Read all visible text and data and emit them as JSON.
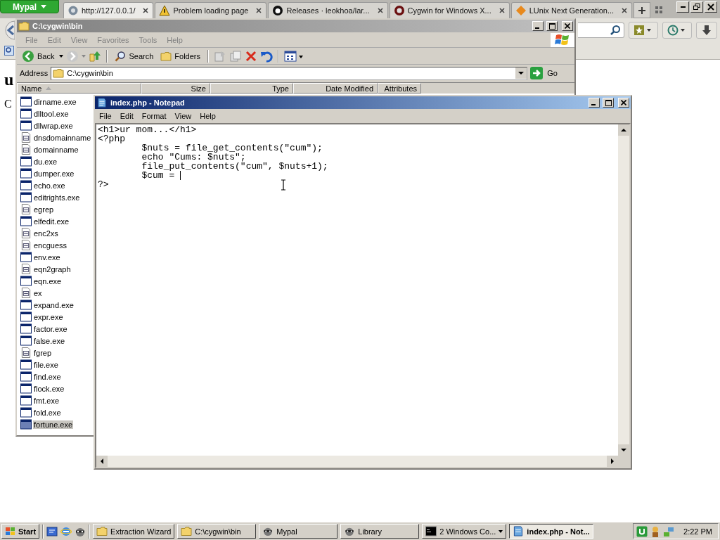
{
  "browser": {
    "menu_button": "Mypal",
    "tabs": [
      {
        "title": "http://127.0.0.1/",
        "kind": "page",
        "selected": true
      },
      {
        "title": "Problem loading page",
        "kind": "warning",
        "selected": false
      },
      {
        "title": "Releases · leokhoa/lar...",
        "kind": "github",
        "selected": false
      },
      {
        "title": "Cygwin for Windows X...",
        "kind": "cygwin",
        "selected": false
      },
      {
        "title": "LUnix Next Generation...",
        "kind": "diamond",
        "selected": false
      }
    ],
    "page_text": [
      "u",
      "C"
    ]
  },
  "explorer": {
    "title": "C:\\cygwin\\bin",
    "menu": [
      "File",
      "Edit",
      "View",
      "Favorites",
      "Tools",
      "Help"
    ],
    "back": "Back",
    "search": "Search",
    "folders": "Folders",
    "address_label": "Address",
    "address": "C:\\cygwin\\bin",
    "go": "Go",
    "columns": [
      "Name",
      "Size",
      "Type",
      "Date Modified",
      "Attributes"
    ],
    "files": [
      {
        "name": "dirname.exe",
        "kind": "exe",
        "selected": false
      },
      {
        "name": "dlltool.exe",
        "kind": "exe",
        "selected": false
      },
      {
        "name": "dllwrap.exe",
        "kind": "exe",
        "selected": false
      },
      {
        "name": "dnsdomainname",
        "kind": "script",
        "selected": false
      },
      {
        "name": "domainname",
        "kind": "script",
        "selected": false
      },
      {
        "name": "du.exe",
        "kind": "exe",
        "selected": false
      },
      {
        "name": "dumper.exe",
        "kind": "exe",
        "selected": false
      },
      {
        "name": "echo.exe",
        "kind": "exe",
        "selected": false
      },
      {
        "name": "editrights.exe",
        "kind": "exe",
        "selected": false
      },
      {
        "name": "egrep",
        "kind": "script",
        "selected": false
      },
      {
        "name": "elfedit.exe",
        "kind": "exe",
        "selected": false
      },
      {
        "name": "enc2xs",
        "kind": "script",
        "selected": false
      },
      {
        "name": "encguess",
        "kind": "script",
        "selected": false
      },
      {
        "name": "env.exe",
        "kind": "exe",
        "selected": false
      },
      {
        "name": "eqn2graph",
        "kind": "script",
        "selected": false
      },
      {
        "name": "eqn.exe",
        "kind": "exe",
        "selected": false
      },
      {
        "name": "ex",
        "kind": "script",
        "selected": false
      },
      {
        "name": "expand.exe",
        "kind": "exe",
        "selected": false
      },
      {
        "name": "expr.exe",
        "kind": "exe",
        "selected": false
      },
      {
        "name": "factor.exe",
        "kind": "exe",
        "selected": false
      },
      {
        "name": "false.exe",
        "kind": "exe",
        "selected": false
      },
      {
        "name": "fgrep",
        "kind": "script",
        "selected": false
      },
      {
        "name": "file.exe",
        "kind": "exe",
        "selected": false
      },
      {
        "name": "find.exe",
        "kind": "exe",
        "selected": false
      },
      {
        "name": "flock.exe",
        "kind": "exe",
        "selected": false
      },
      {
        "name": "fmt.exe",
        "kind": "exe",
        "selected": false
      },
      {
        "name": "fold.exe",
        "kind": "exe",
        "selected": false
      },
      {
        "name": "fortune.exe",
        "kind": "exe",
        "selected": true
      }
    ]
  },
  "notepad": {
    "title": "index.php - Notepad",
    "menu": [
      "File",
      "Edit",
      "Format",
      "View",
      "Help"
    ],
    "lines": [
      {
        "text": "<h1>ur mom...</h1>",
        "caret": false
      },
      {
        "text": "<?php",
        "caret": false
      },
      {
        "text": "\t$nuts = file_get_contents(\"cum\");",
        "caret": false
      },
      {
        "text": "\techo \"Cums: $nuts\";",
        "caret": false
      },
      {
        "text": "\tfile_put_contents(\"cum\", $nuts+1);",
        "caret": false
      },
      {
        "text": "\t$cum = ",
        "caret": true
      },
      {
        "text": "?>",
        "caret": false
      }
    ]
  },
  "taskbar": {
    "start": "Start",
    "buttons": [
      {
        "label": "Extraction Wizard",
        "kind": "folder",
        "selected": false
      },
      {
        "label": "C:\\cygwin\\bin",
        "kind": "folder",
        "selected": false
      },
      {
        "label": "Mypal",
        "kind": "browser",
        "selected": false
      },
      {
        "label": "Library",
        "kind": "browser",
        "selected": false
      },
      {
        "label": "2 Windows Co...",
        "kind": "console",
        "selected": false
      },
      {
        "label": "index.php - Not...",
        "kind": "notepad",
        "selected": true
      }
    ],
    "clock": "2:22 PM"
  }
}
